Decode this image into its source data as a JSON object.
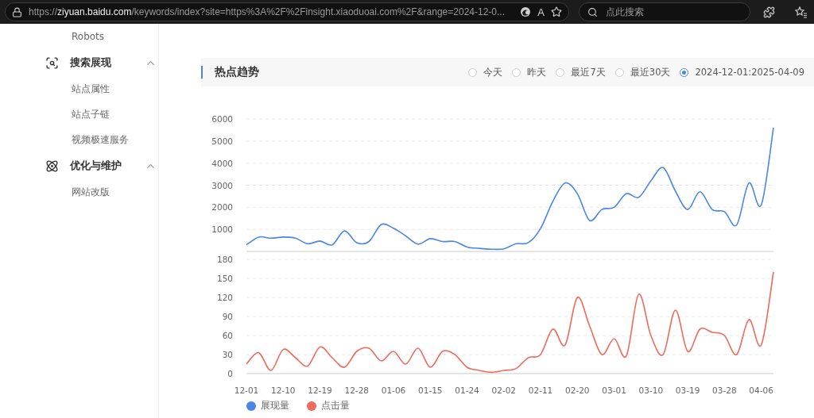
{
  "browser": {
    "url_scheme": "https://",
    "url_host": "ziyuan.baidu.com",
    "url_rest": "/keywords/index?site=https%3A%2F%2Finsight.xiaoduoai.com%2F&range=2024-12-0...",
    "read_aloud_glyph": "A",
    "search_placeholder": "点此搜索"
  },
  "sidebar": {
    "items": [
      {
        "label": "Robots"
      }
    ],
    "groups": [
      {
        "label": "搜索展现",
        "expanded": true,
        "children": [
          {
            "label": "站点属性"
          },
          {
            "label": "站点子链"
          },
          {
            "label": "视频极速服务"
          }
        ]
      },
      {
        "label": "优化与维护",
        "expanded": true,
        "children": [
          {
            "label": "网站改版"
          }
        ]
      }
    ]
  },
  "panel": {
    "title": "热点趋势",
    "range_options": [
      {
        "label": "今天",
        "selected": false
      },
      {
        "label": "昨天",
        "selected": false
      },
      {
        "label": "最近7天",
        "selected": false
      },
      {
        "label": "最近30天",
        "selected": false
      },
      {
        "label": "2024-12-01:2025-04-09",
        "selected": true
      }
    ],
    "charts": [
      {
        "chart_data": {
          "type": "line",
          "categories": [
            null,
            null,
            null,
            null,
            null,
            null,
            null,
            null,
            null,
            null,
            null,
            null,
            null,
            null,
            null,
            null,
            null,
            null,
            null,
            null,
            null,
            null,
            null,
            null,
            null,
            null,
            null,
            null,
            null,
            null,
            null,
            null,
            null,
            null,
            null,
            null,
            null,
            null,
            null,
            null,
            null,
            null,
            null,
            null
          ],
          "ylim": [
            0,
            6000
          ],
          "grid": true,
          "yticks": [
            1000,
            2000,
            3000,
            4000,
            5000,
            6000
          ],
          "series": [
            {
              "name": "展现量",
              "color": "#4a86e8",
              "values": [
                300,
                650,
                600,
                650,
                600,
                350,
                470,
                300,
                930,
                400,
                450,
                1220,
                1050,
                700,
                330,
                580,
                450,
                450,
                200,
                140,
                100,
                120,
                350,
                400,
                1040,
                2270,
                3100,
                2620,
                1400,
                1900,
                2000,
                2620,
                2450,
                3200,
                3800,
                2730,
                1900,
                2700,
                1900,
                1800,
                1200,
                3100,
                2100,
                5600
              ]
            }
          ]
        }
      },
      {
        "chart_data": {
          "type": "line",
          "categories": [
            "12-01",
            null,
            null,
            "12-10",
            null,
            null,
            "12-19",
            null,
            null,
            "12-28",
            null,
            null,
            "01-06",
            null,
            null,
            "01-15",
            null,
            null,
            "01-24",
            null,
            null,
            "02-02",
            null,
            null,
            "02-11",
            null,
            null,
            "02-20",
            null,
            null,
            "03-01",
            null,
            null,
            "03-10",
            null,
            null,
            "03-19",
            null,
            null,
            "03-28",
            null,
            null,
            "04-06",
            null
          ],
          "ylim": [
            0,
            180
          ],
          "grid": true,
          "yticks": [
            0,
            30,
            60,
            90,
            120,
            150,
            180
          ],
          "series": [
            {
              "name": "点击量",
              "color": "#ee6a5a",
              "values": [
                15,
                33,
                5,
                38,
                25,
                12,
                42,
                25,
                10,
                35,
                40,
                20,
                35,
                15,
                40,
                10,
                35,
                30,
                10,
                5,
                2,
                5,
                8,
                25,
                30,
                70,
                45,
                120,
                75,
                30,
                55,
                28,
                125,
                60,
                30,
                100,
                35,
                70,
                65,
                60,
                30,
                85,
                45,
                160
              ]
            }
          ]
        }
      }
    ]
  }
}
